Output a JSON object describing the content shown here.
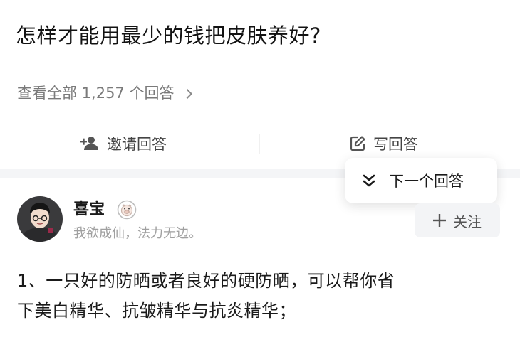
{
  "question": {
    "title": "怎样才能用最少的钱把皮肤养好?"
  },
  "view_all": {
    "label": "查看全部 1,257 个回答"
  },
  "actions": {
    "invite_label": "邀请回答",
    "write_label": "写回答"
  },
  "popup": {
    "next_label": "下一个回答"
  },
  "author": {
    "name": "喜宝",
    "bio": "我欲成仙，法力无边。",
    "follow_label": "关注"
  },
  "answer": {
    "lines": [
      "1、一只好的防晒或者良好的硬防晒，可以帮你省",
      "下美白精华、抗皱精华与抗炎精华；"
    ]
  },
  "colors": {
    "title": "#121212",
    "secondary_text": "#7a7a7a",
    "bio_text": "#a0a0a0",
    "follow_bg": "#f3f4f6",
    "band": "#f4f5f7"
  },
  "icons": {
    "invite": "add-person-icon",
    "write": "edit-pen-icon",
    "next": "double-chevron-down-icon",
    "follow": "plus-icon",
    "view_all": "chevron-right-icon",
    "badge": "pig-badge-icon"
  }
}
